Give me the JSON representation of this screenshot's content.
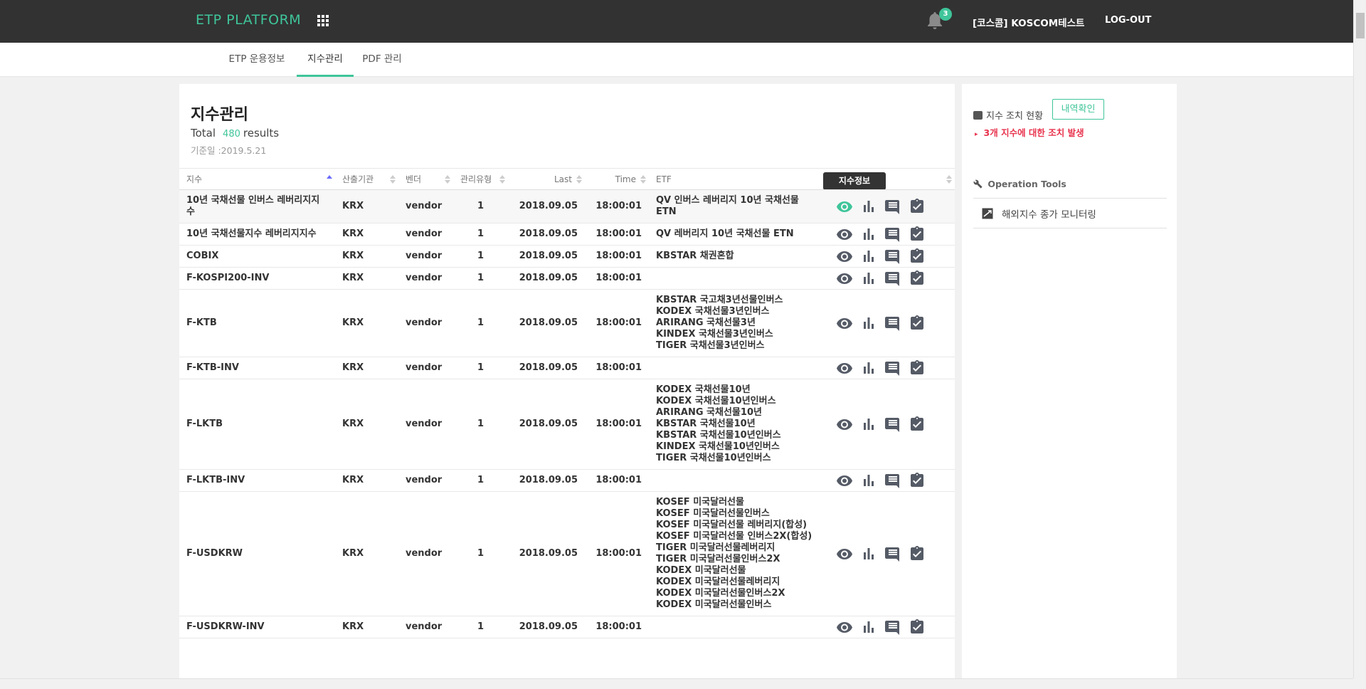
{
  "header": {
    "brand": "ETP PLATFORM",
    "notification_count": "3",
    "user": "[코스콤] KOSCOM테스트",
    "logout": "LOG-OUT"
  },
  "tabs": [
    {
      "label": "ETP 운용정보"
    },
    {
      "label": "지수관리"
    },
    {
      "label": "PDF 관리"
    }
  ],
  "main": {
    "title": "지수관리",
    "total_label": "Total",
    "total_count": "480",
    "results_label": "results",
    "base_date": "기준일 :2019.5.21",
    "tooltip": "지수정보",
    "columns": [
      "지수",
      "산출기관",
      "벤더",
      "관리유형",
      "Last",
      "Time",
      "ETF"
    ],
    "rows": [
      {
        "index": "10년 국채선물 인버스 레버리지지수",
        "agency": "KRX",
        "vendor": "vendor",
        "type": "1",
        "last": "2018.09.05",
        "time": "18:00:01",
        "etf": [
          "QV 인버스 레버리지 10년 국채선물 ETN"
        ]
      },
      {
        "index": "10년 국채선물지수 레버리지지수",
        "agency": "KRX",
        "vendor": "vendor",
        "type": "1",
        "last": "2018.09.05",
        "time": "18:00:01",
        "etf": [
          "QV 레버리지 10년 국채선물 ETN"
        ]
      },
      {
        "index": "COBIX",
        "agency": "KRX",
        "vendor": "vendor",
        "type": "1",
        "last": "2018.09.05",
        "time": "18:00:01",
        "etf": [
          "KBSTAR 채권혼합"
        ]
      },
      {
        "index": "F-KOSPI200-INV",
        "agency": "KRX",
        "vendor": "vendor",
        "type": "1",
        "last": "2018.09.05",
        "time": "18:00:01",
        "etf": []
      },
      {
        "index": "F-KTB",
        "agency": "KRX",
        "vendor": "vendor",
        "type": "1",
        "last": "2018.09.05",
        "time": "18:00:01",
        "etf": [
          "KBSTAR 국고채3년선물인버스",
          "KODEX 국채선물3년인버스",
          "ARIRANG 국채선물3년",
          "KINDEX 국채선물3년인버스",
          "TIGER 국채선물3년인버스"
        ]
      },
      {
        "index": "F-KTB-INV",
        "agency": "KRX",
        "vendor": "vendor",
        "type": "1",
        "last": "2018.09.05",
        "time": "18:00:01",
        "etf": []
      },
      {
        "index": "F-LKTB",
        "agency": "KRX",
        "vendor": "vendor",
        "type": "1",
        "last": "2018.09.05",
        "time": "18:00:01",
        "etf": [
          "KODEX 국채선물10년",
          "KODEX 국채선물10년인버스",
          "ARIRANG 국채선물10년",
          "KBSTAR 국채선물10년",
          "KBSTAR 국채선물10년인버스",
          "KINDEX 국채선물10년인버스",
          "TIGER 국채선물10년인버스"
        ]
      },
      {
        "index": "F-LKTB-INV",
        "agency": "KRX",
        "vendor": "vendor",
        "type": "1",
        "last": "2018.09.05",
        "time": "18:00:01",
        "etf": []
      },
      {
        "index": "F-USDKRW",
        "agency": "KRX",
        "vendor": "vendor",
        "type": "1",
        "last": "2018.09.05",
        "time": "18:00:01",
        "etf": [
          "KOSEF 미국달러선물",
          "KOSEF 미국달러선물인버스",
          "KOSEF 미국달러선물 레버리지(합성)",
          "KOSEF 미국달러선물 인버스2X(합성)",
          "TIGER 미국달러선물레버리지",
          "TIGER 미국달러선물인버스2X",
          "KODEX 미국달러선물",
          "KODEX 미국달러선물레버리지",
          "KODEX 미국달러선물인버스2X",
          "KODEX 미국달러선물인버스"
        ]
      },
      {
        "index": "F-USDKRW-INV",
        "agency": "KRX",
        "vendor": "vendor",
        "type": "1",
        "last": "2018.09.05",
        "time": "18:00:01",
        "etf": []
      }
    ]
  },
  "side": {
    "status_label": "지수 조치 현황",
    "history_button": "내역확인",
    "alert": "3개 지수에 대한 조치 발생",
    "tools_title": "Operation Tools",
    "tool_item": "해외지수 종가 모니터링"
  },
  "colors": {
    "accent": "#3fc59a",
    "topbar": "#323232",
    "alert": "#e8334d",
    "icon": "#555b66"
  }
}
